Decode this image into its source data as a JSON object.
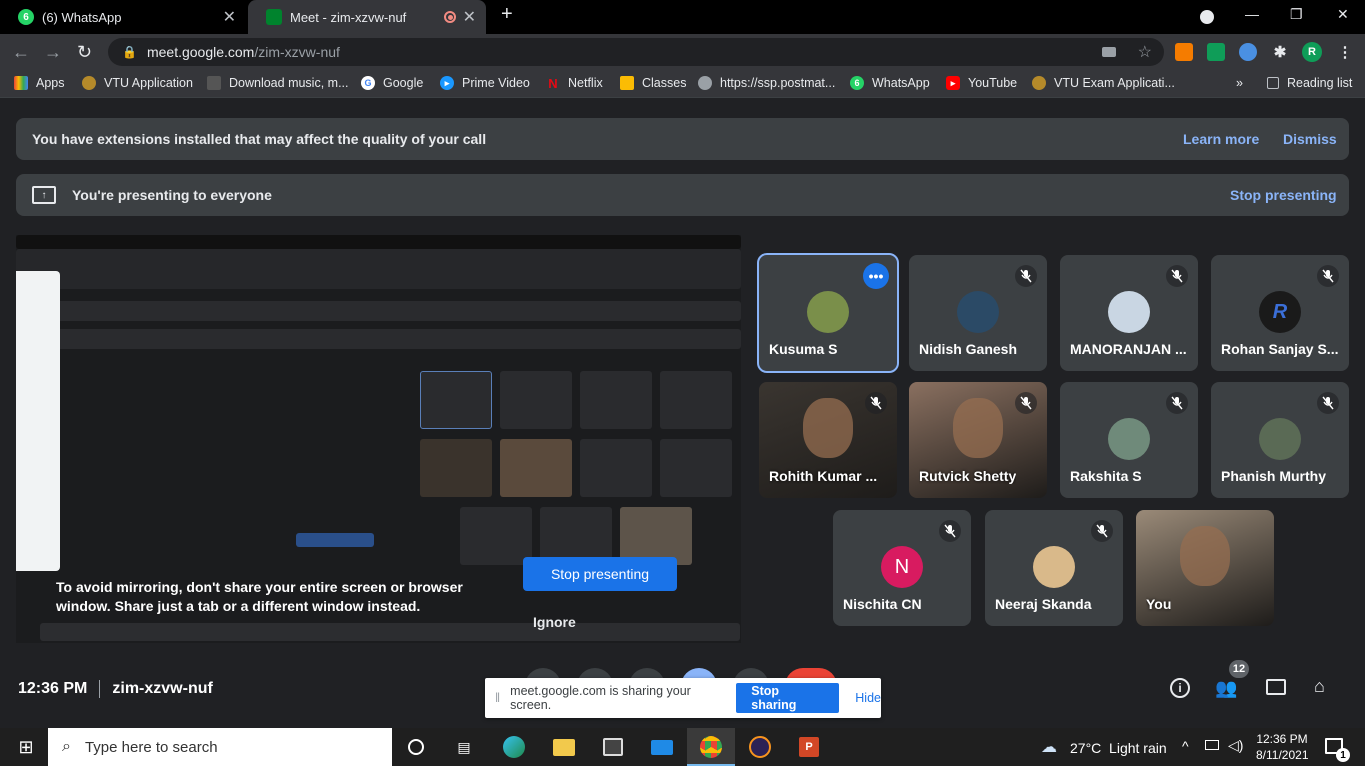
{
  "browser": {
    "tabs": [
      {
        "title": "(6) WhatsApp",
        "badge": "6"
      },
      {
        "title": "Meet - zim-xzvw-nuf"
      }
    ],
    "url_host": "meet.google.com",
    "url_path": "/zim-xzvw-nuf",
    "profile_initial": "R",
    "bookmarks": [
      "Apps",
      "VTU Application",
      "Download music, m...",
      "Google",
      "Prime Video",
      "Netflix",
      "Classes",
      "https://ssp.postmat...",
      "WhatsApp",
      "YouTube",
      "VTU Exam Applicati..."
    ],
    "bookmarks_overflow": "»",
    "reading_list": "Reading list"
  },
  "meet": {
    "extension_banner": {
      "text": "You have extensions installed that may affect the quality of your call",
      "learn_more": "Learn more",
      "dismiss": "Dismiss"
    },
    "presenting_banner": {
      "text": "You're presenting to everyone",
      "stop": "Stop presenting"
    },
    "mirror_warning": "To avoid mirroring, don't share your entire screen or browser window. Share just a tab or a different window instead.",
    "stop_presenting_button": "Stop presenting",
    "ignore_button": "Ignore",
    "participants": [
      {
        "name": "Kusuma S",
        "kind": "avatar",
        "color": "#7a8f4a",
        "muted": false,
        "speaking": true
      },
      {
        "name": "Nidish Ganesh",
        "kind": "avatar",
        "color": "#2b4a66",
        "muted": true
      },
      {
        "name": "MANORANJAN ...",
        "kind": "avatar",
        "color": "#c9d6e3",
        "muted": true
      },
      {
        "name": "Rohan Sanjay S...",
        "kind": "logo",
        "logo": "R",
        "color": "#1a1a1a",
        "muted": true
      },
      {
        "name": "Rohith Kumar ...",
        "kind": "video",
        "color": "#3a3530",
        "muted": true
      },
      {
        "name": "Rutvick Shetty",
        "kind": "video",
        "color": "#8a7060",
        "muted": true
      },
      {
        "name": "Rakshita S",
        "kind": "avatar",
        "color": "#6f8a7a",
        "muted": true
      },
      {
        "name": "Phanish Murthy",
        "kind": "avatar",
        "color": "#5a6a55",
        "muted": true
      },
      {
        "name": "Nischita CN",
        "kind": "initial",
        "initial": "N",
        "color": "#d81b60",
        "muted": true
      },
      {
        "name": "Neeraj Skanda",
        "kind": "avatar",
        "color": "#d9b98a",
        "muted": true
      },
      {
        "name": "You",
        "kind": "video",
        "color": "#9a8a78",
        "muted": false
      }
    ],
    "time": "12:36 PM",
    "meeting_code": "zim-xzvw-nuf",
    "participant_count": "12",
    "share_bar": {
      "text": "meet.google.com is sharing your screen.",
      "stop": "Stop sharing",
      "hide": "Hide"
    }
  },
  "taskbar": {
    "search_placeholder": "Type here to search",
    "weather": "27°C  Light rain",
    "time": "12:36 PM",
    "date": "8/11/2021",
    "notif_count": "1"
  }
}
